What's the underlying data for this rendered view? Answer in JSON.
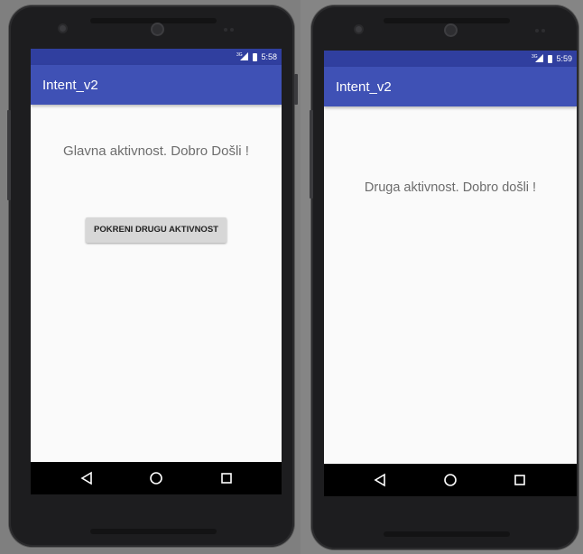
{
  "left_screen": {
    "status_time": "5:58",
    "network_label": "3G",
    "app_title": "Intent_v2",
    "message": "Glavna aktivnost. Dobro Došli !",
    "button_label": "POKRENI DRUGU AKTIVNOST"
  },
  "right_screen": {
    "status_time": "5:59",
    "network_label": "3G",
    "app_title": "Intent_v2",
    "message": "Druga aktivnost. Dobro došli !"
  },
  "nav_icons": [
    "back-icon",
    "home-icon",
    "recents-icon"
  ],
  "colors": {
    "status_bar": "#303f9f",
    "app_bar": "#3f51b5",
    "screen_bg": "#fafafa",
    "device_body": "#1d1d1f"
  }
}
